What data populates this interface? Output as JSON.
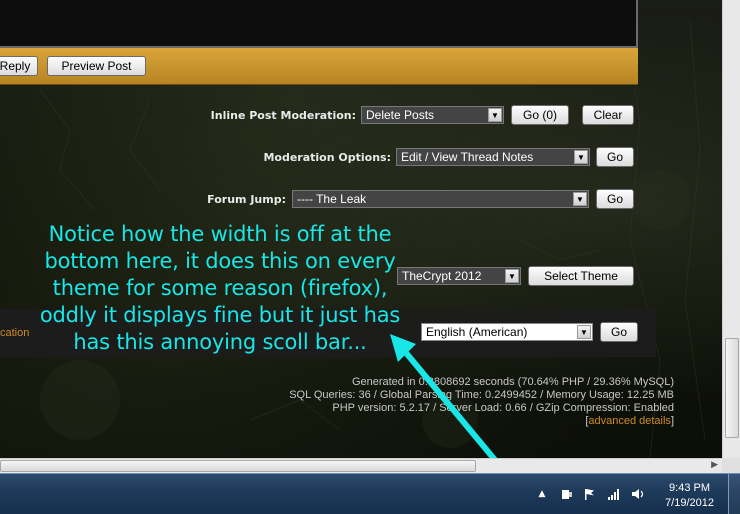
{
  "reply_bar": {
    "reply_label": "Reply",
    "preview_label": "Preview Post"
  },
  "moderation": {
    "inline_label": "Inline Post Moderation:",
    "inline_value": "Delete Posts",
    "inline_go_label": "Go (0)",
    "clear_label": "Clear",
    "options_label": "Moderation Options:",
    "options_value": "Edit / View Thread Notes",
    "options_go_label": "Go"
  },
  "forum_jump": {
    "label": "Forum Jump:",
    "value": "---- The Leak",
    "go_label": "Go"
  },
  "theme": {
    "value": "TheCrypt 2012",
    "select_label": "Select Theme"
  },
  "language": {
    "link_fragment": "cation",
    "value": "English (American)",
    "go_label": "Go"
  },
  "stats": {
    "line1": "Generated in 0.3808692 seconds (70.64% PHP / 29.36% MySQL)",
    "line2": "SQL Queries: 36 / Global Parsing Time: 0.2499452 / Memory Usage: 12.25 MB",
    "line3": "PHP version: 5.2.17 / Server Load: 0.66 / GZip Compression: Enabled",
    "open_bracket": "[",
    "advanced_link": "advanced details",
    "close_bracket": "]"
  },
  "annotation": {
    "line1": "Notice how the width is off at the",
    "line2": "bottom here, it does this on every",
    "line3": "theme for some reason (firefox),",
    "line4": "oddly it displays fine but it just has",
    "line5": "has this annoying scoll bar..."
  },
  "taskbar": {
    "time": "9:43 PM",
    "date": "7/19/2012"
  },
  "colors": {
    "annotation": "#19e6e6",
    "reply_bar": "#c8952e",
    "link": "#d08b28"
  },
  "icons": [
    "chevron-up-icon",
    "power-icon",
    "flag-icon",
    "signal-icon",
    "speaker-icon",
    "dropdown-arrow-icon"
  ]
}
